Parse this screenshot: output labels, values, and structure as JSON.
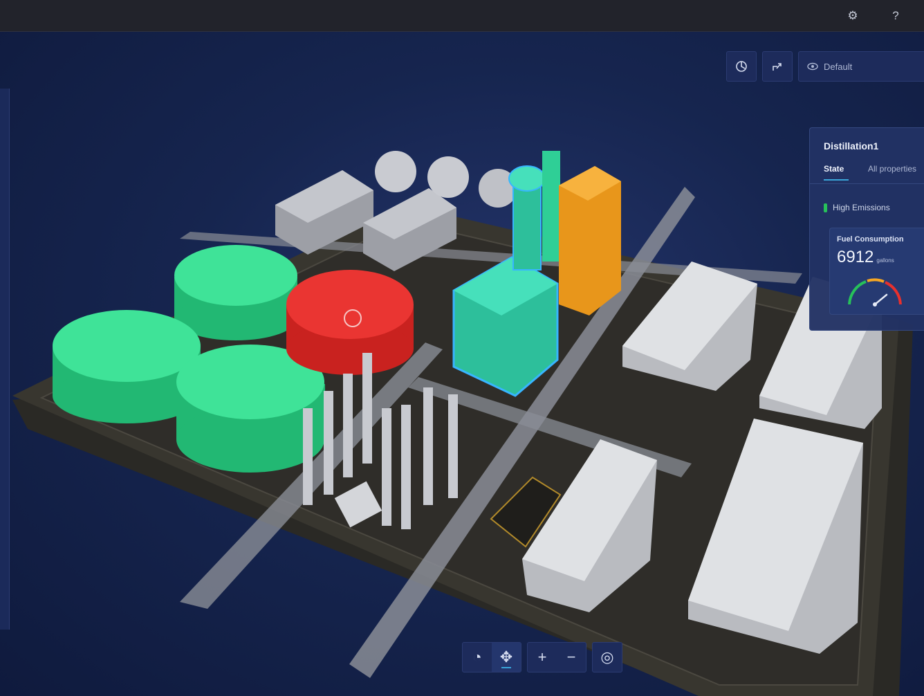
{
  "topbar": {
    "icons": [
      {
        "name": "gear-icon",
        "glyph": "⚙"
      },
      {
        "name": "help-icon",
        "glyph": "?"
      }
    ]
  },
  "view_toolbar": {
    "buttons": [
      {
        "name": "orbit-view-icon"
      },
      {
        "name": "share-icon"
      }
    ],
    "view_select": {
      "icon": "eye-icon",
      "value": "Default"
    }
  },
  "panel": {
    "title": "Distillation1",
    "tabs": [
      {
        "label": "State",
        "active": true
      },
      {
        "label": "All properties",
        "active": false
      }
    ],
    "status": {
      "label": "High Emissions",
      "color": "#27c15a"
    },
    "fuel": {
      "label": "Fuel Consumption",
      "value": "6912",
      "unit": "gallons",
      "level": 0.78
    }
  },
  "bottom_toolbar": {
    "groups": [
      [
        {
          "name": "compass-icon",
          "glyph": "◔"
        },
        {
          "name": "move-icon",
          "glyph": "✥",
          "active": true
        }
      ],
      [
        {
          "name": "zoom-in-icon",
          "glyph": "+"
        },
        {
          "name": "zoom-out-icon",
          "glyph": "−"
        }
      ],
      [
        {
          "name": "globe-icon",
          "glyph": "◎"
        }
      ]
    ]
  },
  "colors": {
    "background": "#16254f",
    "tank_green": "#2fd68a",
    "tank_red": "#e8302d",
    "tower_cyan": "#3fd9b6",
    "tower_orange": "#f5a623",
    "accent": "#3aa5d8"
  }
}
